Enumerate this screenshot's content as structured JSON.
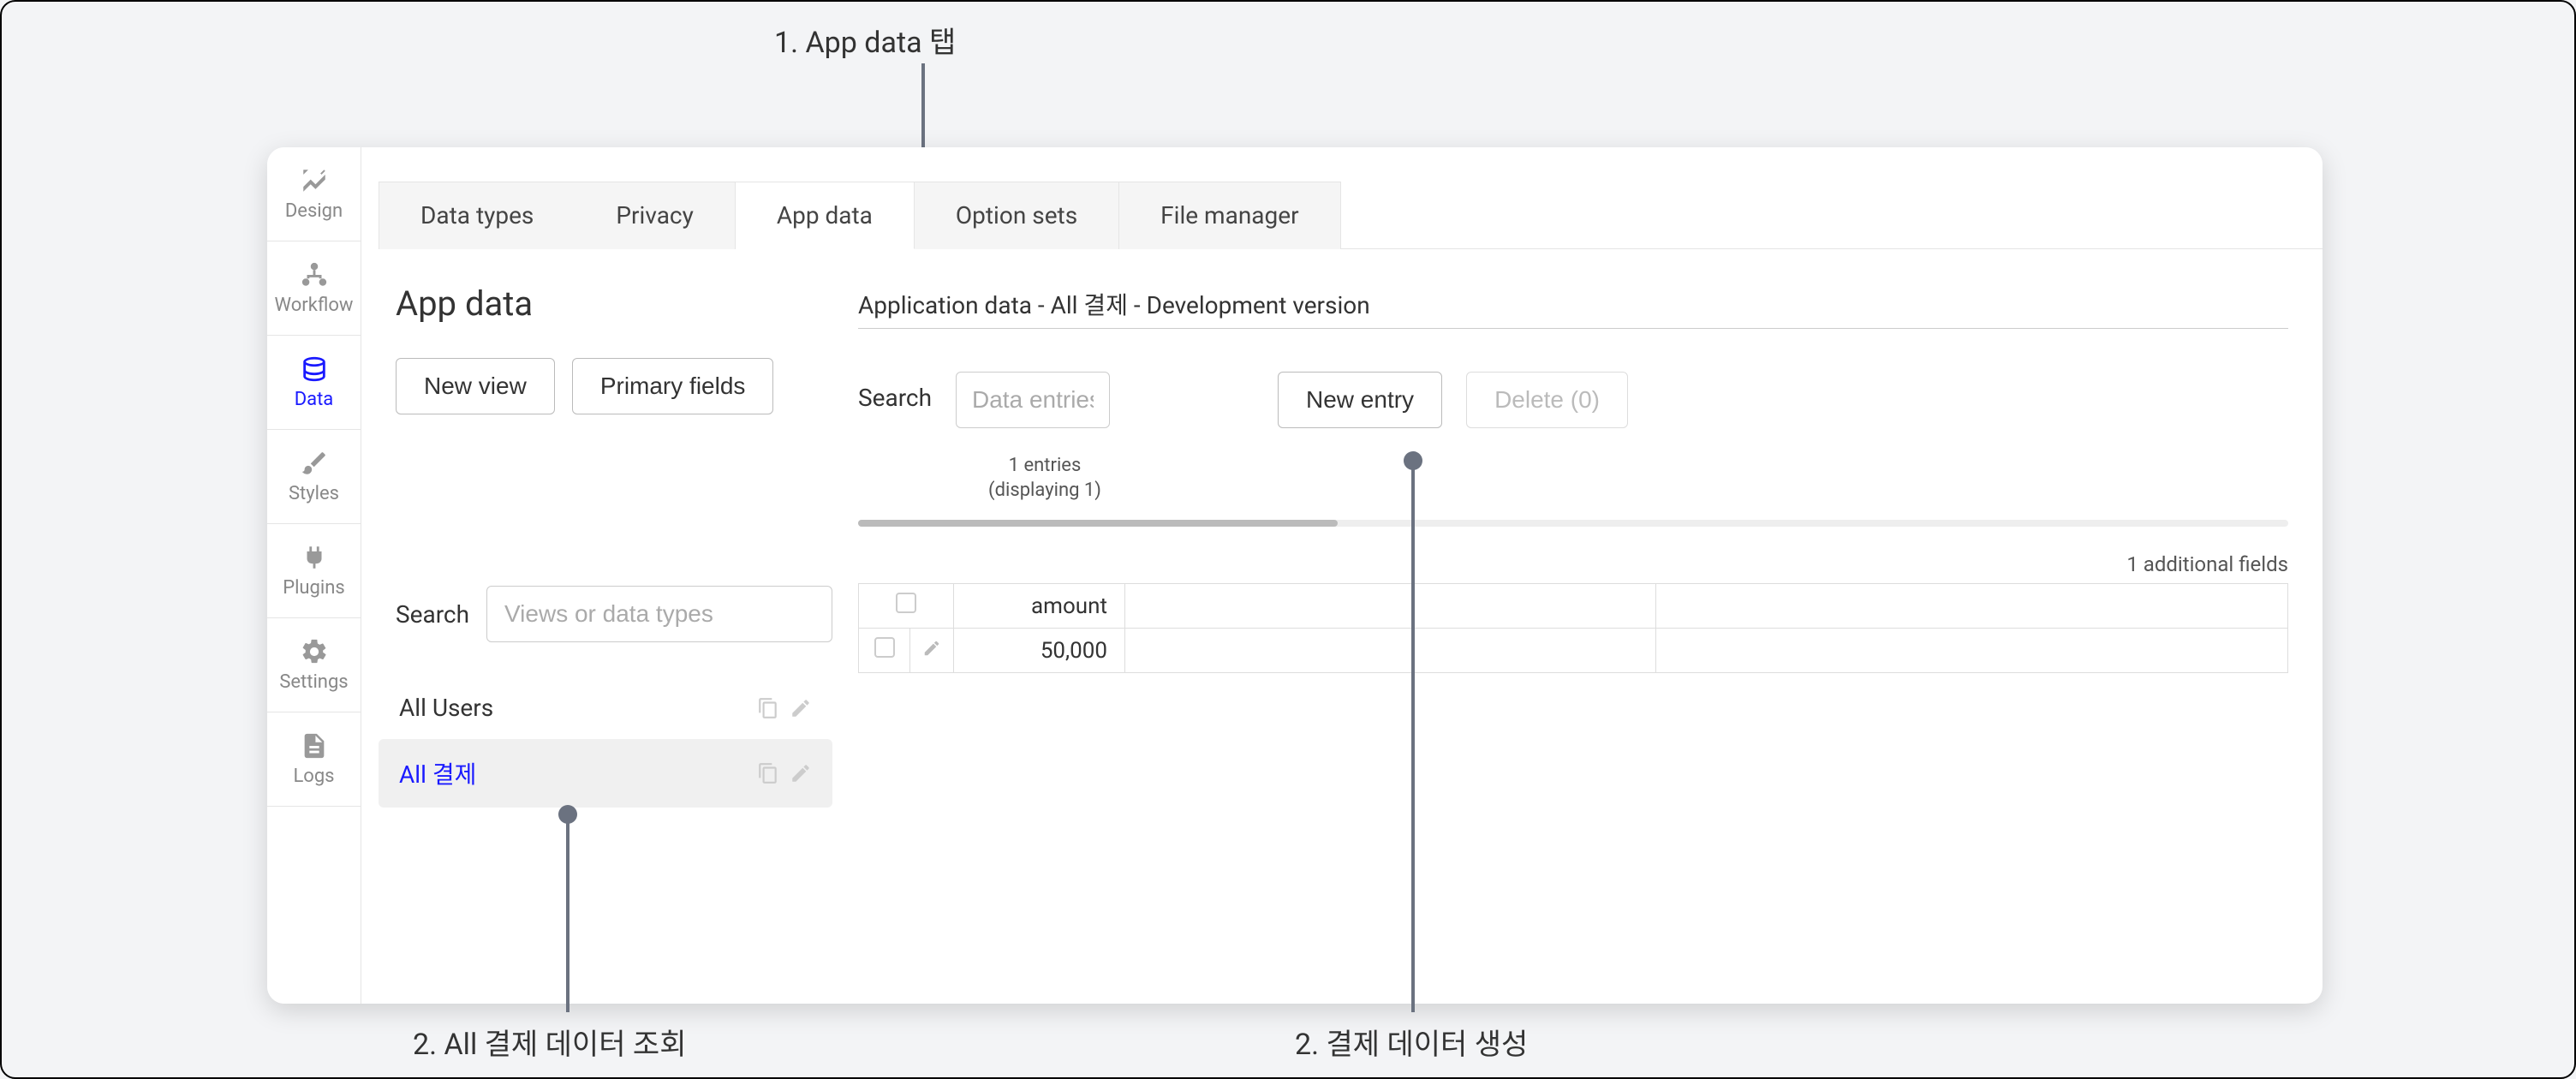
{
  "annotations": {
    "top": "1. App data 탭",
    "bottom_left": "2. All 결제 데이터 조회",
    "bottom_right": "2. 결제 데이터 생성"
  },
  "sidebar": {
    "items": [
      {
        "label": "Design"
      },
      {
        "label": "Workflow"
      },
      {
        "label": "Data"
      },
      {
        "label": "Styles"
      },
      {
        "label": "Plugins"
      },
      {
        "label": "Settings"
      },
      {
        "label": "Logs"
      }
    ]
  },
  "tabs": [
    {
      "label": "Data types"
    },
    {
      "label": "Privacy"
    },
    {
      "label": "App data"
    },
    {
      "label": "Option sets"
    },
    {
      "label": "File manager"
    }
  ],
  "left": {
    "title": "App data",
    "new_view": "New view",
    "primary_fields": "Primary fields",
    "search_label": "Search",
    "search_placeholder": "Views or data types",
    "views": [
      {
        "label": "All Users"
      },
      {
        "label": "All 결제"
      }
    ]
  },
  "right": {
    "title": "Application data - All 결제 - Development version",
    "search_label": "Search",
    "search_placeholder": "Data entries",
    "new_entry": "New entry",
    "delete": "Delete (0)",
    "entries_info": "1 entries (displaying 1)",
    "additional_fields": "1 additional fields",
    "columns": {
      "amount": "amount"
    },
    "rows": [
      {
        "amount": "50,000"
      }
    ]
  }
}
